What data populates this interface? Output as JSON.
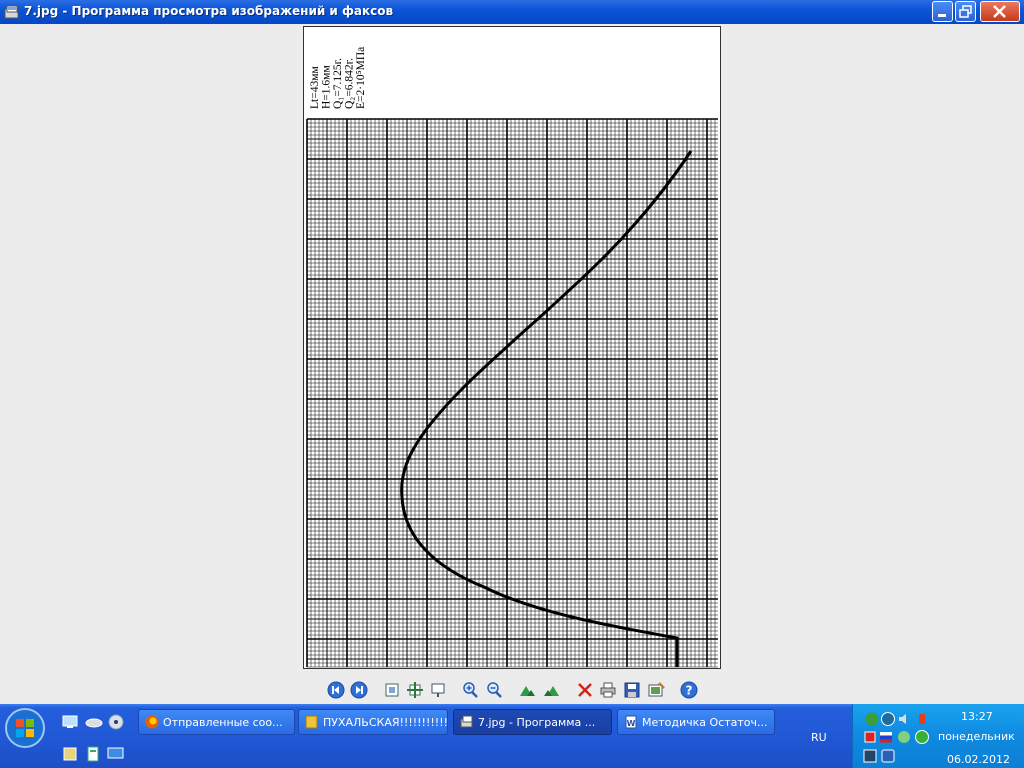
{
  "window": {
    "title": "7.jpg - Программа просмотра изображений и факсов"
  },
  "image": {
    "params": [
      "Lt=43мм",
      "H=1.6мм",
      "Q₁=7.125г.",
      "Q₂=6.842г.",
      "E=2·10⁵МПа"
    ]
  },
  "toolbar": {
    "buttons": [
      "prev-image",
      "next-image",
      "best-fit",
      "actual-size",
      "slideshow",
      "zoom-in",
      "zoom-out",
      "rotate-clockwise",
      "rotate-counterclockwise",
      "delete",
      "print",
      "save",
      "edit",
      "help"
    ]
  },
  "taskbar": {
    "tasks": [
      {
        "label": "Отправленные соо..."
      },
      {
        "label": "ПУХАЛЬСКАЯ!!!!!!!!!!!!"
      },
      {
        "label": "7.jpg - Программа ..."
      },
      {
        "label": "Методичка Остаточ..."
      }
    ],
    "language": "RU",
    "clock": {
      "time": "13:27",
      "day": "понедельник",
      "date": "06.02.2012"
    }
  },
  "colors": {
    "titlebar": "#0a55d8",
    "taskbar": "#245edb",
    "tray": "#0f8ae0"
  }
}
